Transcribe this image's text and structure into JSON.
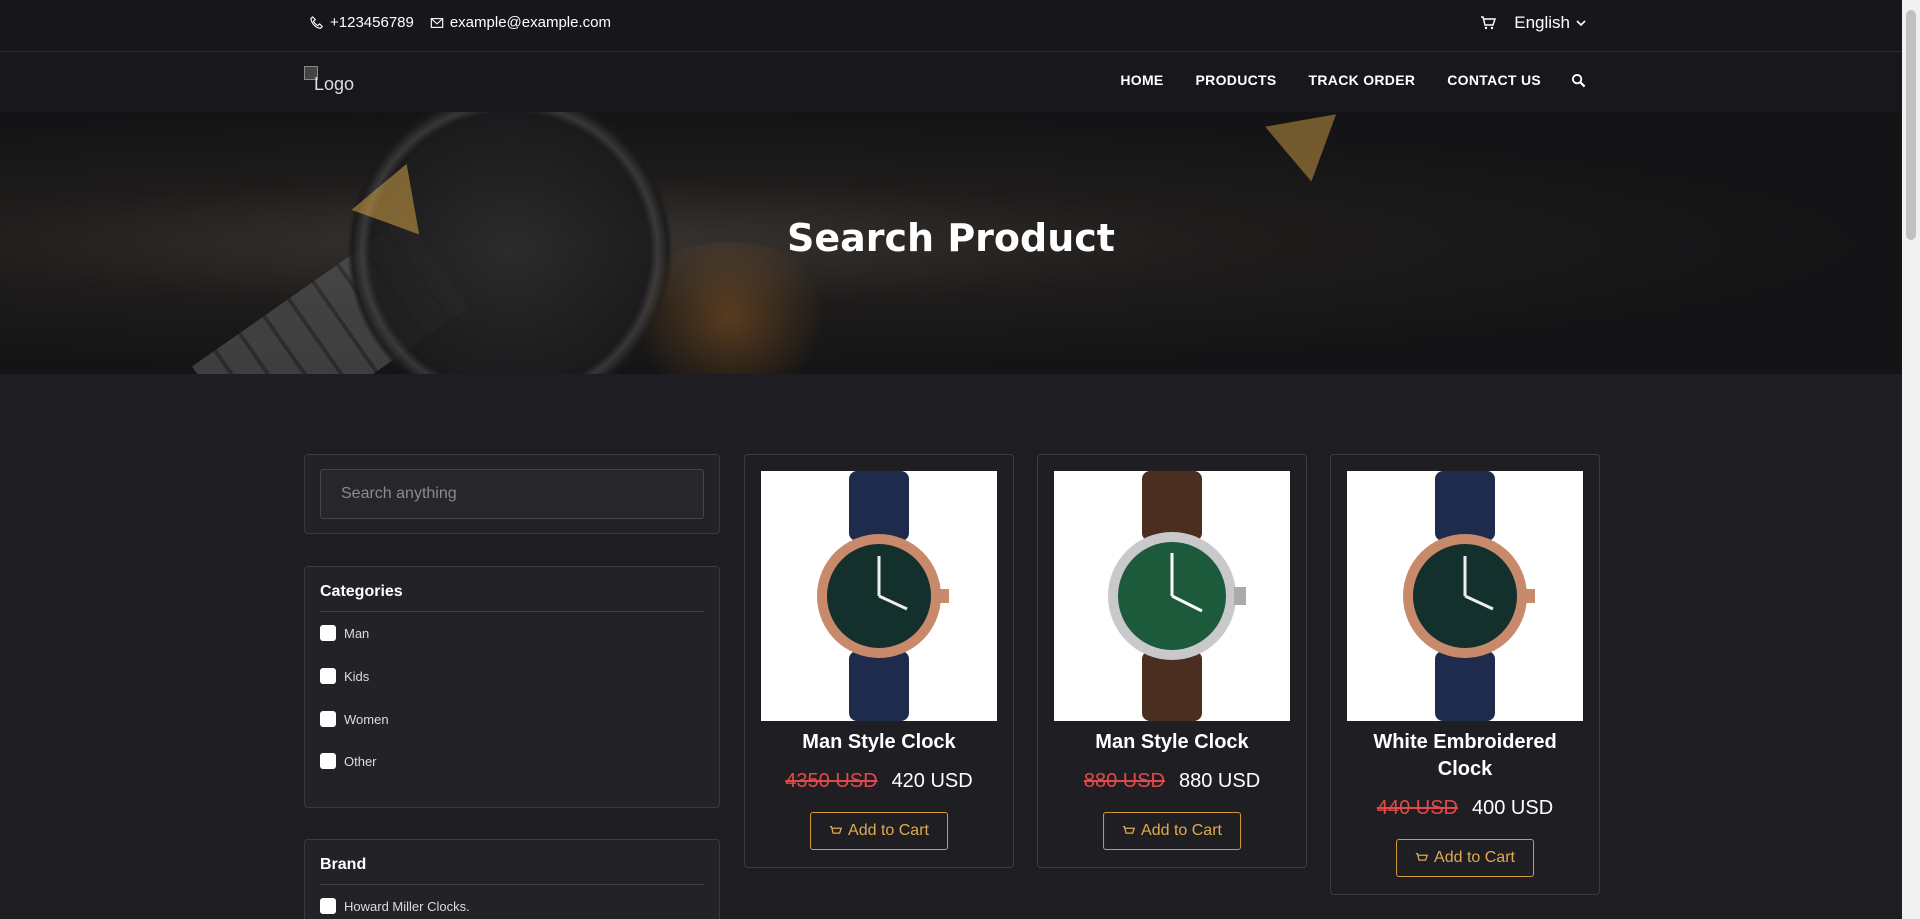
{
  "topbar": {
    "phone": "+123456789",
    "email": "example@example.com",
    "language": "English"
  },
  "logo_alt": "Logo",
  "nav": [
    "HOME",
    "PRODUCTS",
    "TRACK ORDER",
    "CONTACT US"
  ],
  "hero": {
    "title": "Search Product"
  },
  "search": {
    "placeholder": "Search anything"
  },
  "categories": {
    "title": "Categories",
    "items": [
      "Man",
      "Kids",
      "Women",
      "Other"
    ]
  },
  "brand": {
    "title": "Brand",
    "items": [
      "Howard Miller Clocks."
    ]
  },
  "products": [
    {
      "name": "Man Style Clock",
      "old_price": "4350 USD",
      "price": "420 USD",
      "button": "Add to Cart"
    },
    {
      "name": "Man Style Clock",
      "old_price": "880 USD",
      "price": "880 USD",
      "button": "Add to Cart"
    },
    {
      "name": "White Embroidered Clock",
      "old_price": "440 USD",
      "price": "400 USD",
      "button": "Add to Cart"
    }
  ],
  "colors": {
    "accent": "#d49a3a",
    "strike": "#e24a4a",
    "bg": "#1e1e22"
  }
}
